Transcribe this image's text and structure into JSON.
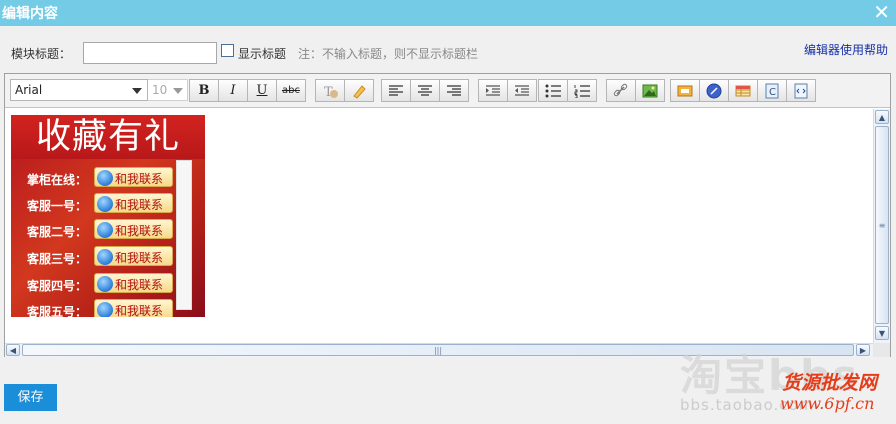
{
  "dialog": {
    "title": "编辑内容",
    "close_glyph": "✕"
  },
  "form": {
    "module_title_label": "模块标题：",
    "module_title_value": "",
    "show_title_label": "显示标题",
    "show_title_checked": false,
    "hint": "注：不输入标题，则不显示标题栏",
    "help_link": "编辑器使用帮助"
  },
  "toolbar": {
    "font_family": "Arial",
    "font_size": "10",
    "bold": "B",
    "italic": "I",
    "underline": "U",
    "strike": "abc"
  },
  "banner": {
    "heading": "收藏有礼",
    "contact_label": "和我联系",
    "rows": [
      "掌柜在线：",
      "客服一号：",
      "客服二号：",
      "客服三号：",
      "客服四号：",
      "客服五号："
    ]
  },
  "save_button": "保存",
  "watermark": {
    "logo": "淘宝bbs",
    "bbs_url": "bbs.taobao.com",
    "red_text": "货源批发网",
    "red_url": "www.6pf.cn"
  },
  "colors": {
    "title_bar": "#74cbe6",
    "save": "#1a8ed8",
    "link": "#1530a8"
  }
}
